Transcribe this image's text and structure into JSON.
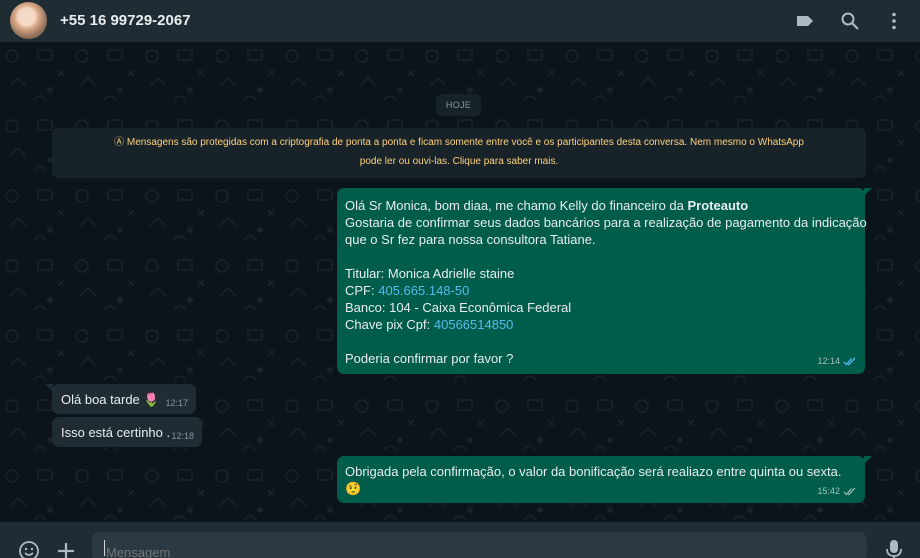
{
  "header": {
    "contact": "+55 16 99729-2067",
    "icons": [
      "label-icon",
      "search-icon",
      "kebab-menu-icon"
    ]
  },
  "chat": {
    "date_chip": "HOJE",
    "e2e_notice": {
      "line1": "Ⓐ Mensagens são protegidas com a criptografia de ponta a ponta e ficam somente entre você e os participantes desta conversa. Nem mesmo o WhatsApp",
      "line2": "pode ler ou ouvi-las. Clique para saber mais."
    },
    "messages": [
      {
        "direction": "out",
        "line1_prefix": "Olá Sr Monica, bom diaa, me chamo Kelly do financeiro da ",
        "line1_bold": "Proteauto",
        "line2": "Gostaria de confirmar seus dados bancários para a realização de pagamento da indicação",
        "line3": "que o Sr fez para nossa consultora Tatiane.",
        "titular": "Titular: Monica Adrielle staine",
        "cpf_label": "CPF: ",
        "cpf_value": "405.665.148-50",
        "banco": "Banco: 104 - Caixa Econômica Federal",
        "pix_label": "Chave pix Cpf: ",
        "pix_value": "40566514850",
        "closing": "Poderia confirmar por favor ?",
        "time": "12:14"
      },
      {
        "direction": "in",
        "text": "Olá boa tarde",
        "emoji": "🌷",
        "time": "12:17"
      },
      {
        "direction": "in",
        "text": "Isso está certinho .",
        "time": "12:18"
      },
      {
        "direction": "out",
        "text": "Obrigada pela confirmação, o valor da bonificação será realiazo entre quinta ou sexta.",
        "emoji": "🤨",
        "time": "15:42"
      }
    ]
  },
  "footer": {
    "placeholder": "Mensagem",
    "icons": [
      "emoji-icon",
      "attach-plus-icon",
      "microphone-icon"
    ]
  },
  "colors": {
    "header_bg": "#202c33",
    "chat_bg": "#0b141a",
    "outgoing_bubble": "#005c4b",
    "incoming_bubble": "#202c33",
    "notice_text": "#ffd279",
    "link": "#53bdeb",
    "read_ticks": "#53bdeb"
  }
}
